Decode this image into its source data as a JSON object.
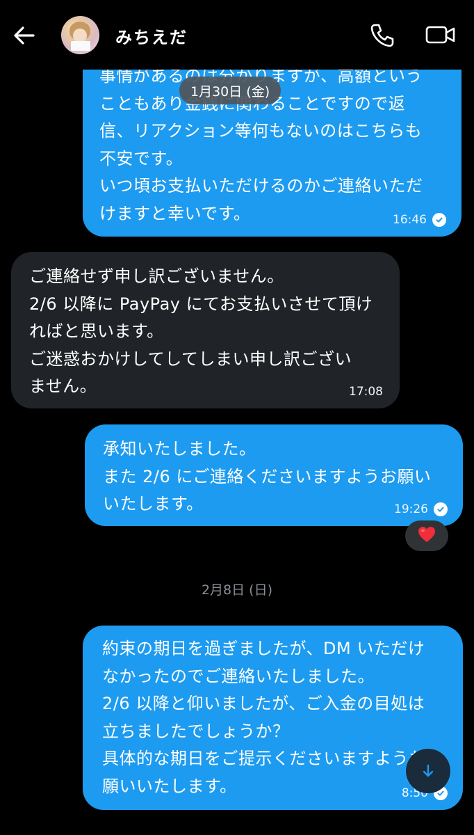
{
  "header": {
    "contact_name": "みちえだ"
  },
  "date_pill": "1月30日 (金)",
  "messages": [
    {
      "direction": "out",
      "text": "事情があるのは分かりますが、高額という\nこともあり金銭に関わることですので返\n信、リアクション等何もないのはこちらも\n不安です。\nいつ頃お支払いただけるのかご連絡いただ\nけますと幸いです。",
      "time": "16:46"
    },
    {
      "direction": "in",
      "text": "ご連絡せず申し訳ございません。\n2/6 以降に PayPay にてお支払いさせて頂け\nればと思います。\nご迷惑おかけしてしてしまい申し訳ござい\nません。",
      "time": "17:08"
    },
    {
      "direction": "out",
      "text": "承知いたしました。\nまた 2/6 にご連絡くださいますようお願い\nいたします。",
      "time": "19:26",
      "reaction": "❤️"
    },
    {
      "direction": "out",
      "text": "約束の期日を過ぎましたが、DM いただけ\nなかったのでご連絡いたしました。\n2/6 以降と仰いましたが、ご入金の目処は\n立ちましたでしょうか？\n具体的な期日をご提示くださいますようお\n願いいたします。",
      "time": "8:50"
    }
  ],
  "date_separator": "2月8日 (日)",
  "icons": {
    "back": "back-arrow-icon",
    "call": "phone-icon",
    "video": "video-camera-icon",
    "read": "read-check-icon",
    "scroll": "arrow-down-icon"
  },
  "colors": {
    "background": "#000000",
    "outgoing_bubble": "#1d9bf0",
    "incoming_bubble": "#202327"
  }
}
